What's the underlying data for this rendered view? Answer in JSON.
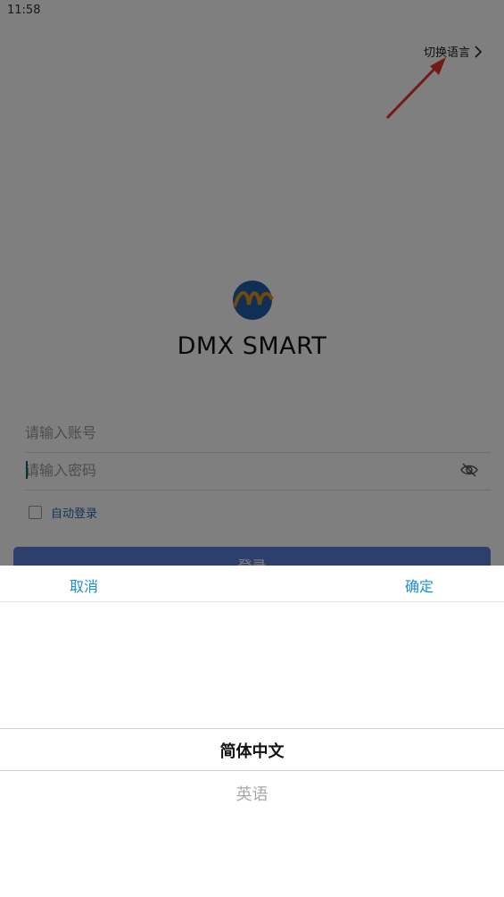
{
  "status_bar": {
    "time": "11:58"
  },
  "header": {
    "switch_language": "切换语言"
  },
  "app": {
    "title": "DMX SMART"
  },
  "form": {
    "account_placeholder": "请输入账号",
    "password_placeholder": "请输入密码",
    "auto_login": "自动登录",
    "login_button": "登录"
  },
  "picker": {
    "cancel": "取消",
    "confirm": "确定",
    "options": [
      "简体中文",
      "英语"
    ],
    "selected": "简体中文"
  },
  "colors": {
    "accent": "#1a8fd0",
    "annotation_arrow": "#e8352c",
    "login_button": "#5b7fd6",
    "overlay": "rgba(0,0,0,0.5)"
  },
  "icons": {
    "switch_language_chevron": "chevron-right-icon",
    "password_visibility": "eye-off-icon",
    "logo": "dmx-logo"
  }
}
